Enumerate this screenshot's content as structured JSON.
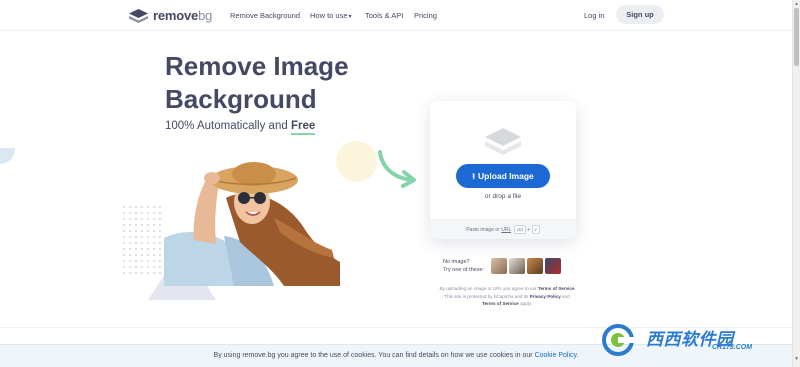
{
  "header": {
    "logo_main": "remove",
    "logo_suffix": "bg",
    "nav": [
      {
        "label": "Remove Background"
      },
      {
        "label": "How to use"
      },
      {
        "label": "Tools & API"
      },
      {
        "label": "Pricing"
      }
    ],
    "login": "Log in",
    "signup": "Sign up"
  },
  "hero": {
    "title_line1": "Remove Image",
    "title_line2": "Background",
    "subtitle_prefix": "100% Automatically and ",
    "subtitle_emphasis": "Free"
  },
  "upload": {
    "button_label": "Upload Image",
    "drop_text": "or drop a file",
    "paste_prefix": "Paste image or ",
    "paste_url": "URL",
    "key_ctrl": "ctrl",
    "key_plus": "+",
    "key_v": "v"
  },
  "samples": {
    "no_image_line1": "No image?",
    "no_image_line2": "Try one of these:",
    "thumb_colors": [
      "#b48b6a",
      "#7c6a5e",
      "#a0683a",
      "#8a2a2a"
    ]
  },
  "legal": {
    "line1_prefix": "By uploading an image or URL you agree to our ",
    "terms": "Terms of Service",
    "line2_prefix": "This site is protected by hCaptcha and its ",
    "privacy": "Privacy Policy",
    "line2_mid": " and",
    "line3_suffix": " apply."
  },
  "cookie": {
    "text": "By using remove.bg you agree to the use of cookies. You can find details on how we use cookies in our ",
    "link": "Cookie Policy",
    "end": "."
  },
  "watermark": {
    "main": "西西软件园",
    "sub": "CR173.COM"
  },
  "colors": {
    "primary": "#1c69d4",
    "text": "#454964",
    "free_underline": "#84d4a8",
    "arrow": "#84d4a8"
  }
}
